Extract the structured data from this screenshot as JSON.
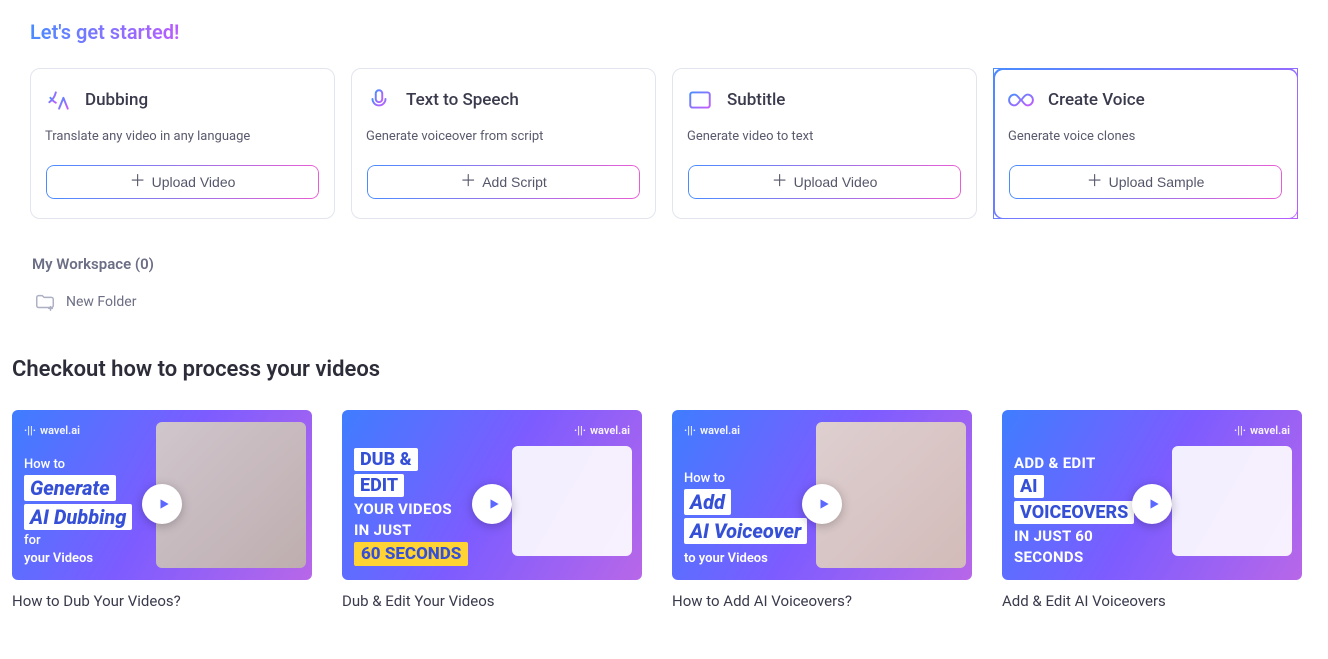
{
  "page_title": "Let's get started!",
  "cards": [
    {
      "title": "Dubbing",
      "desc": "Translate any video in any language",
      "button": "Upload Video",
      "icon": "translate-icon",
      "highlight": false
    },
    {
      "title": "Text to Speech",
      "desc": "Generate voiceover from script",
      "button": "Add Script",
      "icon": "microphone-icon",
      "highlight": false
    },
    {
      "title": "Subtitle",
      "desc": "Generate video to text",
      "button": "Upload Video",
      "icon": "subtitle-icon",
      "highlight": false
    },
    {
      "title": "Create Voice",
      "desc": "Generate voice clones",
      "button": "Upload Sample",
      "icon": "infinity-icon",
      "highlight": true
    }
  ],
  "workspace": {
    "title": "My Workspace (0)",
    "new_folder_label": "New Folder"
  },
  "section_title": "Checkout how to process your videos",
  "videos": [
    {
      "label": "How to Dub Your Videos?",
      "thumb_variant": "dub-generate"
    },
    {
      "label": "Dub & Edit Your Videos",
      "thumb_variant": "dub-edit"
    },
    {
      "label": "How to Add AI Voiceovers?",
      "thumb_variant": "add-voiceover"
    },
    {
      "label": "Add & Edit AI Voiceovers",
      "thumb_variant": "edit-voiceover"
    }
  ],
  "thumb_text": {
    "brand": "wavel.ai",
    "dub_generate": {
      "l1": "How to",
      "l2": "Generate",
      "l3": "AI Dubbing",
      "l4": "for",
      "l5": "your Videos"
    },
    "dub_edit": {
      "l1": "DUB &",
      "l2": "EDIT",
      "l3": "YOUR VIDEOS",
      "l4": "IN JUST",
      "l5": "60 SECONDS"
    },
    "add_vo": {
      "l1": "How to",
      "l2": "Add",
      "l3": "AI Voiceover",
      "l4": "to your Videos"
    },
    "edit_vo": {
      "l1": "ADD & EDIT",
      "l2": "AI",
      "l3": "VOICEOVERS",
      "l4": "IN JUST 60",
      "l5": "SECONDS"
    }
  },
  "colors": {
    "accent_blue": "#4a8cff",
    "accent_purple": "#b95cff"
  }
}
